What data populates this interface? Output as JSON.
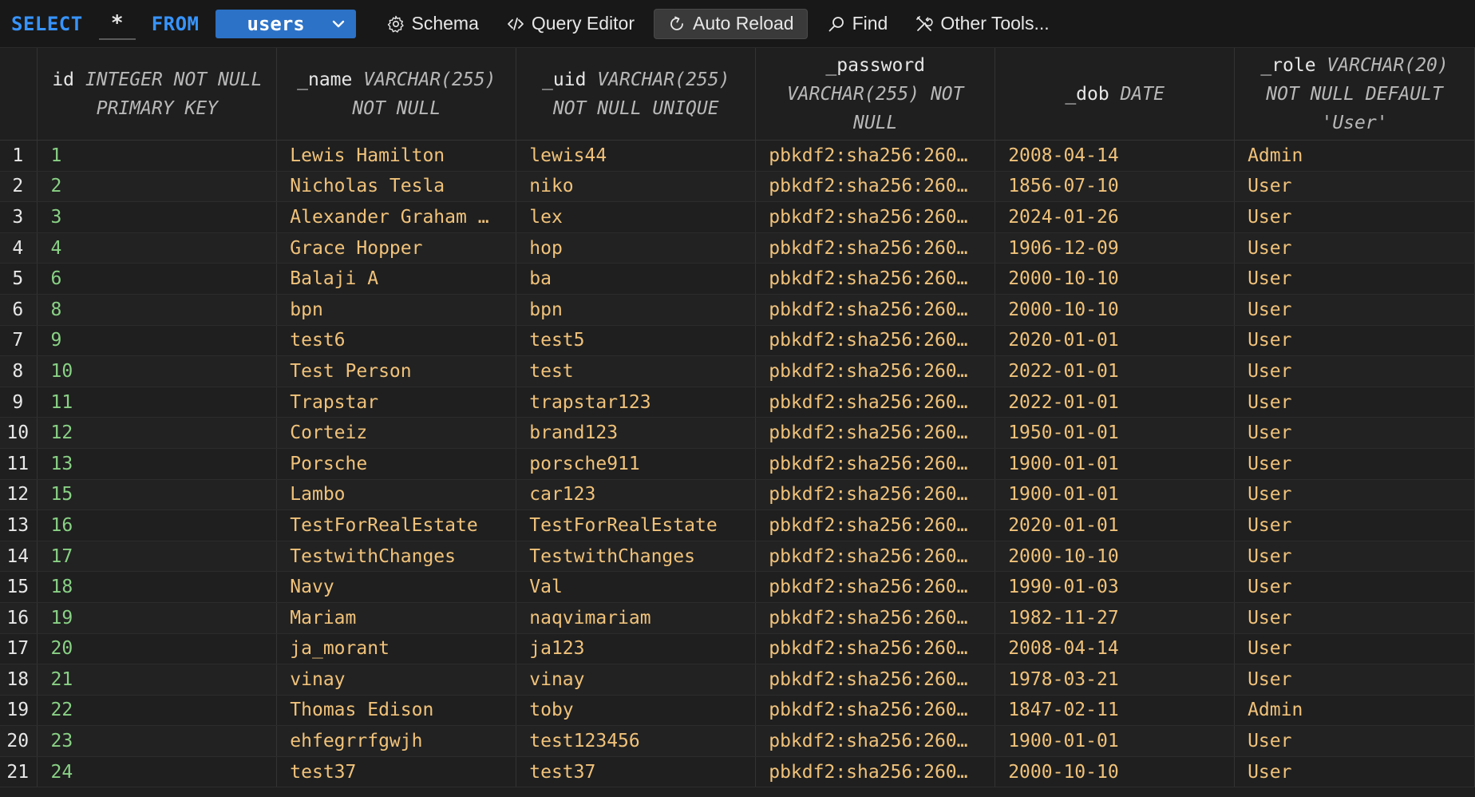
{
  "toolbar": {
    "select_kw": "SELECT",
    "star": "*",
    "from_kw": "FROM",
    "table_name": "users",
    "schema_label": "Schema",
    "query_editor_label": "Query Editor",
    "auto_reload_label": "Auto Reload",
    "find_label": "Find",
    "other_tools_label": "Other Tools..."
  },
  "columns": [
    {
      "name": "id",
      "type": "INTEGER NOT NULL PRIMARY KEY",
      "line1_name": "id",
      "line1_type": "INTEGER NOT NULL",
      "line2": "PRIMARY KEY",
      "line3": ""
    },
    {
      "name": "_name",
      "type": "VARCHAR(255) NOT NULL",
      "line1_name": "_name",
      "line1_type": "VARCHAR(255)",
      "line2": "NOT NULL",
      "line3": ""
    },
    {
      "name": "_uid",
      "type": "VARCHAR(255) NOT NULL UNIQUE",
      "line1_name": "_uid",
      "line1_type": "VARCHAR(255)",
      "line2": "NOT NULL UNIQUE",
      "line3": ""
    },
    {
      "name": "_password",
      "type": "VARCHAR(255) NOT NULL",
      "line1_name": "_password",
      "line1_type": "",
      "line2": "VARCHAR(255) NOT",
      "line3": "NULL"
    },
    {
      "name": "_dob",
      "type": "DATE",
      "line1_name": "_dob",
      "line1_type": "DATE",
      "line2": "",
      "line3": ""
    },
    {
      "name": "_role",
      "type": "VARCHAR(20) NOT NULL DEFAULT 'User'",
      "line1_name": "_role",
      "line1_type": "VARCHAR(20)",
      "line2": "NOT NULL DEFAULT",
      "line3": "'User'"
    }
  ],
  "rows": [
    {
      "rn": "1",
      "id": "1",
      "name": "Lewis Hamilton",
      "uid": "lewis44",
      "password": "pbkdf2:sha256:260…",
      "dob": "2008-04-14",
      "role": "Admin"
    },
    {
      "rn": "2",
      "id": "2",
      "name": "Nicholas Tesla",
      "uid": "niko",
      "password": "pbkdf2:sha256:260…",
      "dob": "1856-07-10",
      "role": "User"
    },
    {
      "rn": "3",
      "id": "3",
      "name": "Alexander Graham …",
      "uid": "lex",
      "password": "pbkdf2:sha256:260…",
      "dob": "2024-01-26",
      "role": "User"
    },
    {
      "rn": "4",
      "id": "4",
      "name": "Grace Hopper",
      "uid": "hop",
      "password": "pbkdf2:sha256:260…",
      "dob": "1906-12-09",
      "role": "User"
    },
    {
      "rn": "5",
      "id": "6",
      "name": "Balaji A",
      "uid": "ba",
      "password": "pbkdf2:sha256:260…",
      "dob": "2000-10-10",
      "role": "User"
    },
    {
      "rn": "6",
      "id": "8",
      "name": "bpn",
      "uid": "bpn",
      "password": "pbkdf2:sha256:260…",
      "dob": "2000-10-10",
      "role": "User"
    },
    {
      "rn": "7",
      "id": "9",
      "name": "test6",
      "uid": "test5",
      "password": "pbkdf2:sha256:260…",
      "dob": "2020-01-01",
      "role": "User"
    },
    {
      "rn": "8",
      "id": "10",
      "name": "Test Person",
      "uid": "test",
      "password": "pbkdf2:sha256:260…",
      "dob": "2022-01-01",
      "role": "User"
    },
    {
      "rn": "9",
      "id": "11",
      "name": "Trapstar",
      "uid": "trapstar123",
      "password": "pbkdf2:sha256:260…",
      "dob": "2022-01-01",
      "role": "User"
    },
    {
      "rn": "10",
      "id": "12",
      "name": "Corteiz",
      "uid": "brand123",
      "password": "pbkdf2:sha256:260…",
      "dob": "1950-01-01",
      "role": "User"
    },
    {
      "rn": "11",
      "id": "13",
      "name": "Porsche",
      "uid": "porsche911",
      "password": "pbkdf2:sha256:260…",
      "dob": "1900-01-01",
      "role": "User"
    },
    {
      "rn": "12",
      "id": "15",
      "name": "Lambo",
      "uid": "car123",
      "password": "pbkdf2:sha256:260…",
      "dob": "1900-01-01",
      "role": "User"
    },
    {
      "rn": "13",
      "id": "16",
      "name": "TestForRealEstate",
      "uid": "TestForRealEstate",
      "password": "pbkdf2:sha256:260…",
      "dob": "2020-01-01",
      "role": "User"
    },
    {
      "rn": "14",
      "id": "17",
      "name": "TestwithChanges",
      "uid": "TestwithChanges",
      "password": "pbkdf2:sha256:260…",
      "dob": "2000-10-10",
      "role": "User"
    },
    {
      "rn": "15",
      "id": "18",
      "name": "Navy",
      "uid": "Val",
      "password": "pbkdf2:sha256:260…",
      "dob": "1990-01-03",
      "role": "User"
    },
    {
      "rn": "16",
      "id": "19",
      "name": "Mariam",
      "uid": "naqvimariam",
      "password": "pbkdf2:sha256:260…",
      "dob": "1982-11-27",
      "role": "User"
    },
    {
      "rn": "17",
      "id": "20",
      "name": "ja_morant",
      "uid": "ja123",
      "password": "pbkdf2:sha256:260…",
      "dob": "2008-04-14",
      "role": "User"
    },
    {
      "rn": "18",
      "id": "21",
      "name": "vinay",
      "uid": "vinay",
      "password": "pbkdf2:sha256:260…",
      "dob": "1978-03-21",
      "role": "User"
    },
    {
      "rn": "19",
      "id": "22",
      "name": "Thomas Edison",
      "uid": "toby",
      "password": "pbkdf2:sha256:260…",
      "dob": "1847-02-11",
      "role": "Admin"
    },
    {
      "rn": "20",
      "id": "23",
      "name": "ehfegrrfgwjh",
      "uid": "test123456",
      "password": "pbkdf2:sha256:260…",
      "dob": "1900-01-01",
      "role": "User"
    },
    {
      "rn": "21",
      "id": "24",
      "name": "test37",
      "uid": "test37",
      "password": "pbkdf2:sha256:260…",
      "dob": "2000-10-10",
      "role": "User"
    }
  ]
}
